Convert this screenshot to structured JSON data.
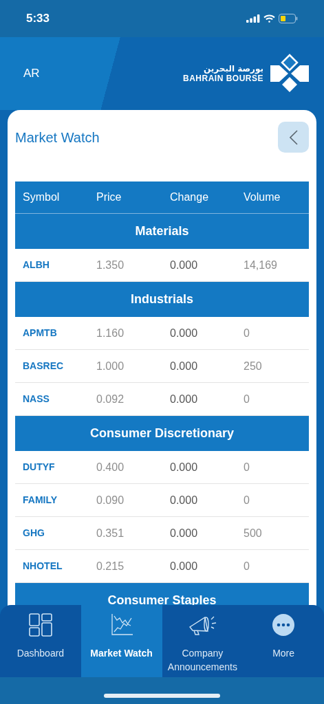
{
  "status_bar": {
    "time": "5:33"
  },
  "header": {
    "language": "AR",
    "logo_arabic": "بورصة البحرين",
    "logo_english": "BAHRAIN BOURSE"
  },
  "card": {
    "title": "Market Watch"
  },
  "table": {
    "columns": [
      "Symbol",
      "Price",
      "Change",
      "Volume"
    ],
    "groups": [
      {
        "name": "Materials",
        "rows": [
          {
            "symbol": "ALBH",
            "price": "1.350",
            "change": "0.000",
            "volume": "14,169"
          }
        ]
      },
      {
        "name": "Industrials",
        "rows": [
          {
            "symbol": "APMTB",
            "price": "1.160",
            "change": "0.000",
            "volume": "0"
          },
          {
            "symbol": "BASREC",
            "price": "1.000",
            "change": "0.000",
            "volume": "250"
          },
          {
            "symbol": "NASS",
            "price": "0.092",
            "change": "0.000",
            "volume": "0"
          }
        ]
      },
      {
        "name": "Consumer Discretionary",
        "rows": [
          {
            "symbol": "DUTYF",
            "price": "0.400",
            "change": "0.000",
            "volume": "0"
          },
          {
            "symbol": "FAMILY",
            "price": "0.090",
            "change": "0.000",
            "volume": "0"
          },
          {
            "symbol": "GHG",
            "price": "0.351",
            "change": "0.000",
            "volume": "500"
          },
          {
            "symbol": "NHOTEL",
            "price": "0.215",
            "change": "0.000",
            "volume": "0"
          }
        ]
      },
      {
        "name": "Consumer Staples"
      }
    ]
  },
  "tab_bar": [
    {
      "kind": "dashboard",
      "label": "Dashboard",
      "selected": false
    },
    {
      "kind": "chart",
      "label": "Market Watch",
      "selected": true
    },
    {
      "kind": "megaphone",
      "label": "Company Announcements",
      "selected": false
    },
    {
      "kind": "more",
      "label": "More",
      "selected": false
    }
  ]
}
